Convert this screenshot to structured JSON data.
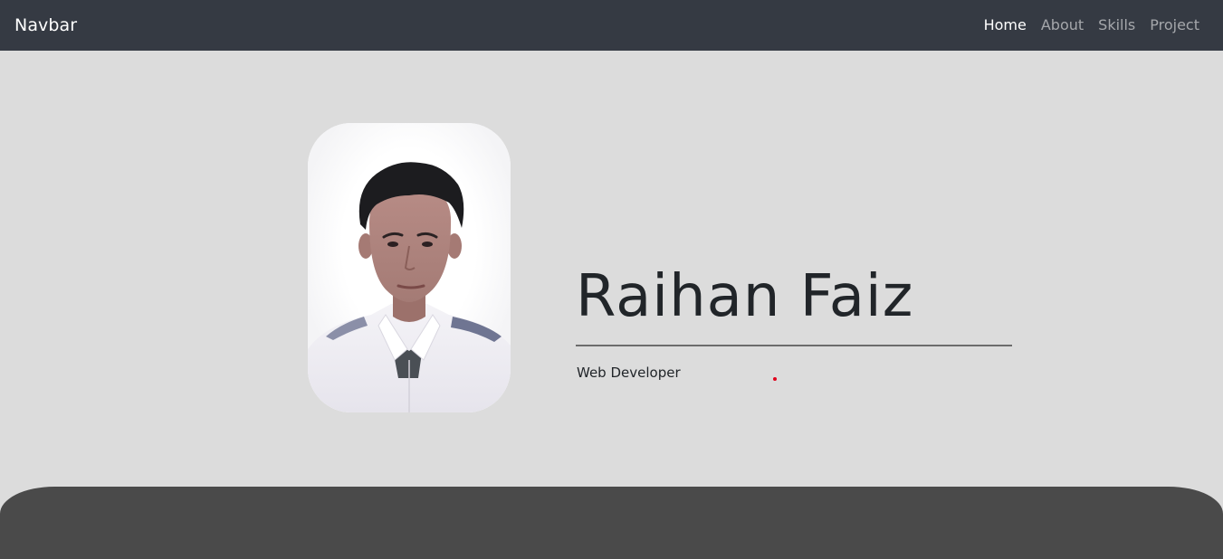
{
  "navbar": {
    "brand": "Navbar",
    "links": [
      {
        "label": "Home",
        "active": true
      },
      {
        "label": "About",
        "active": false
      },
      {
        "label": "Skills",
        "active": false
      },
      {
        "label": "Project",
        "active": false
      }
    ]
  },
  "hero": {
    "name": "Raihan Faiz",
    "role": "Web Developer",
    "photo_icon": "profile-photo"
  },
  "colors": {
    "navbar_bg": "#353a43",
    "page_bg": "#dcdcdc",
    "footer_bg": "#4a4a4a",
    "text": "#212529"
  }
}
